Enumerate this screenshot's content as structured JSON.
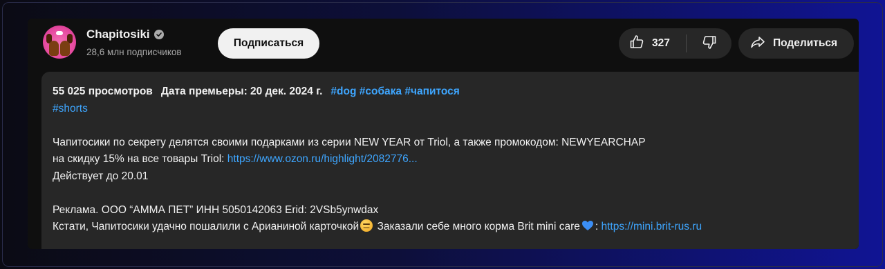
{
  "channel": {
    "name": "Chapitosiki",
    "verified_icon": "verified-check-icon",
    "subscribers": "28,6 млн подписчиков",
    "avatar_icon": "channel-avatar-dogs"
  },
  "actions": {
    "subscribe_label": "Подписаться",
    "like_count": "327",
    "like_icon": "thumbs-up-icon",
    "dislike_icon": "thumbs-down-icon",
    "share_label": "Поделиться",
    "share_icon": "share-arrow-icon"
  },
  "description": {
    "views": "55 025 просмотров",
    "premiere": "Дата премьеры: 20 дек. 2024 г.",
    "tags_line1": "#dog #собака #чапитося",
    "tags_line2": "#shorts",
    "para1_line1": "Чапитосики по секрету делятся своими подарками из серии NEW YEAR от Triol, а также промокодом: NEWYEARCHAP",
    "para1_line2_text": "на скидку 15% на все товары Triol: ",
    "para1_line2_link": "https://www.ozon.ru/highlight/2082776...",
    "para1_line3": "Действует до 20.01",
    "para2_line1": "Реклама. ООО “АММА ПЕТ” ИНН 5050142063 Erid: 2VSb5ynwdax",
    "para2_line2_text_a": "Кстати, Чапитосики удачно пошалили с Арианиной карточкой",
    "para2_line2_emoji1": "smirking-face-emoji",
    "para2_line2_text_b": " Заказали себе много корма Brit mini care",
    "para2_line2_emoji2": "blue-heart-emoji",
    "para2_line2_sep": ": ",
    "para2_line2_link": "https://mini.brit-rus.ru"
  },
  "colors": {
    "background": "#0f0f0f",
    "button_bg": "#272727",
    "link": "#3ea6ff",
    "subscribe_bg": "#f1f1f1",
    "avatar_pink": "#e64aa0"
  }
}
